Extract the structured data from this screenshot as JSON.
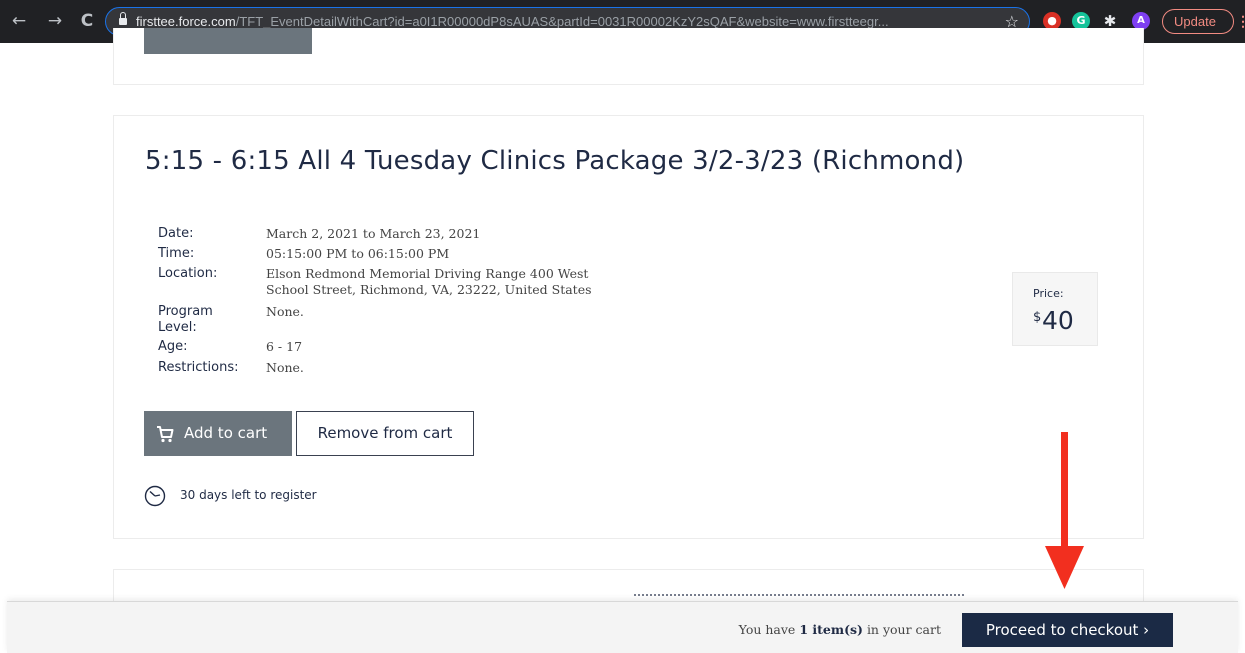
{
  "browser": {
    "back": "←",
    "forward": "→",
    "reload": "C",
    "url_host": "firsttee.force.com",
    "url_path": "/TFT_EventDetailWithCart?id=a0I1R00000dP8sAUAS&partId=0031R00002KzY2sQAF&website=www.firstteegr...",
    "star": "☆",
    "ext_green_letter": "G",
    "ext_puzzle": "✱",
    "avatar_letter": "A",
    "update_label": "Update",
    "menu": "⋮"
  },
  "event": {
    "title": "5:15 - 6:15 All 4 Tuesday Clinics Package 3/2-3/23 (Richmond)",
    "details": {
      "date_label": "Date:",
      "date_value": "March 2, 2021 to March 23, 2021",
      "time_label": "Time:",
      "time_value": "05:15:00 PM to 06:15:00 PM",
      "location_label": "Location:",
      "location_line1": "Elson Redmond Memorial Driving Range 400 West",
      "location_line2": "School Street, Richmond, VA, 23222, United States",
      "level_label_line1": "Program",
      "level_label_line2": "Level:",
      "level_value": "None.",
      "age_label": "Age:",
      "age_value": "6 - 17",
      "restrictions_label": "Restrictions:",
      "restrictions_value": "None."
    },
    "price": {
      "label": "Price:",
      "currency": "$",
      "amount": "40"
    },
    "add_to_cart_label": "Add to cart",
    "remove_from_cart_label": "Remove from cart",
    "days_left": "30 days left to register"
  },
  "cart_bar": {
    "prefix": "You have",
    "count": "1 item(s)",
    "suffix": "in your cart",
    "checkout_label": "Proceed to checkout ›"
  },
  "colors": {
    "accent_navy": "#1b2a45",
    "button_gray": "#6b757d",
    "annotation_red": "#f22f1f"
  }
}
